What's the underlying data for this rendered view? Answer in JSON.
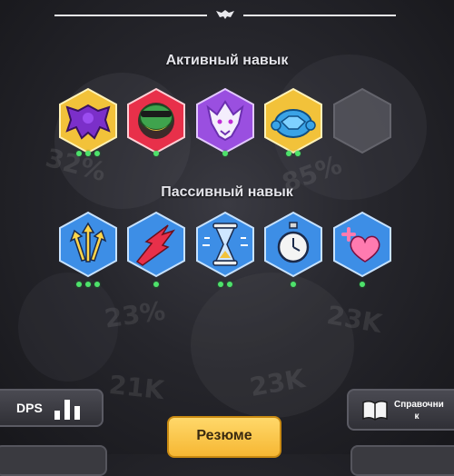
{
  "headings": {
    "active": "Активный навык",
    "passive": "Пассивный навык"
  },
  "active_skills": [
    {
      "icon": "bat-wing-icon",
      "frame": "gold",
      "level_dots": 3
    },
    {
      "icon": "green-frog-bandit-icon",
      "frame": "red",
      "level_dots": 1
    },
    {
      "icon": "white-wolf-spirit-icon",
      "frame": "purple",
      "level_dots": 1
    },
    {
      "icon": "blue-turtle-shell-icon",
      "frame": "gold",
      "level_dots": 2
    },
    {
      "icon": "empty-slot",
      "frame": "gray",
      "level_dots": 0
    }
  ],
  "passive_skills": [
    {
      "icon": "triple-arrows-up-icon",
      "frame": "blue",
      "level_dots": 3
    },
    {
      "icon": "red-slash-dash-icon",
      "frame": "blue",
      "level_dots": 1
    },
    {
      "icon": "hourglass-icon",
      "frame": "blue",
      "level_dots": 2
    },
    {
      "icon": "stopwatch-icon",
      "frame": "blue",
      "level_dots": 1
    },
    {
      "icon": "heart-plus-icon",
      "frame": "blue",
      "level_dots": 1
    }
  ],
  "buttons": {
    "dps": "DPS",
    "guide_line1": "Справочни",
    "guide_line2": "к",
    "resume": "Резюме"
  },
  "colors": {
    "dot": "#4ee26b",
    "resume_button": "#f6b733",
    "gold_frame": "#f2c23a",
    "blue_frame": "#3d8ee6",
    "red_frame": "#e8304a",
    "purple_frame": "#9a4fe0"
  }
}
